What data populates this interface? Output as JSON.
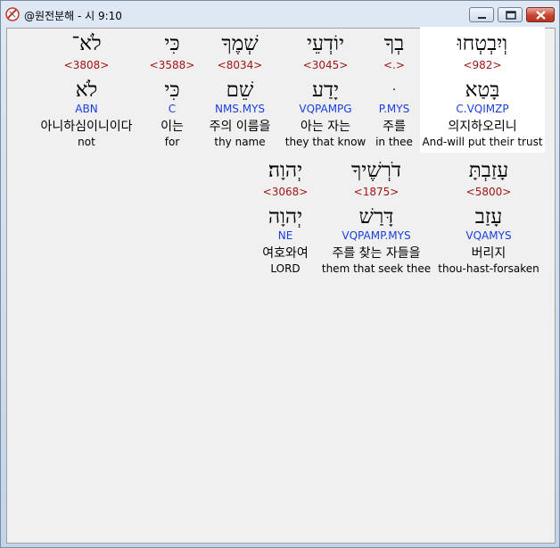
{
  "window": {
    "title": "@원전분해 - 시 9:10"
  },
  "rows": [
    {
      "words": [
        {
          "hebrew": "לֹא־",
          "strong": "<3808>",
          "lemma": "לֹא",
          "morph": "ABN",
          "korean": "아니하심이니이다",
          "english": "not"
        },
        {
          "hebrew": "כִּי",
          "strong": "<3588>",
          "lemma": "כִּי",
          "morph": "C",
          "korean": "이는",
          "english": "for"
        },
        {
          "hebrew": "שְׁמֶךָ",
          "strong": "<8034>",
          "lemma": "שֵׁם",
          "morph": "NMS.MYS",
          "korean": "주의 이름을",
          "english": "thy name"
        },
        {
          "hebrew": "יוֹדְעֵי",
          "strong": "<3045>",
          "lemma": "יָדַע",
          "morph": "VQPAMPG",
          "korean": "아는 자는",
          "english": "they that know"
        },
        {
          "hebrew": "בְךָ",
          "strong": "<.>",
          "lemma": "ּ",
          "morph": "P.MYS",
          "korean": "주를",
          "english": "in thee"
        },
        {
          "hebrew": "וְיִבְטְחוּ",
          "strong": "<982>",
          "lemma": "בָּטַא",
          "morph": "C.VQIMZP",
          "korean": "의지하오리니",
          "english": "And-will put their trust"
        }
      ]
    },
    {
      "words": [
        {
          "hebrew": "יְהוָה׃",
          "strong": "<3068>",
          "lemma": "יְהוָה",
          "morph": "NE",
          "korean": "여호와여",
          "english": "LORD"
        },
        {
          "hebrew": "דֹרְשֶׁיךָ",
          "strong": "<1875>",
          "lemma": "דָּרַשׁ",
          "morph": "VQPAMP.MYS",
          "korean": "주를 찾는 자들을",
          "english": "them that seek thee"
        },
        {
          "hebrew": "עָזַבְתָּ",
          "strong": "<5800>",
          "lemma": "עָזַב",
          "morph": "VQAMYS",
          "korean": "버리지",
          "english": "thou-hast-forsaken"
        }
      ]
    }
  ]
}
